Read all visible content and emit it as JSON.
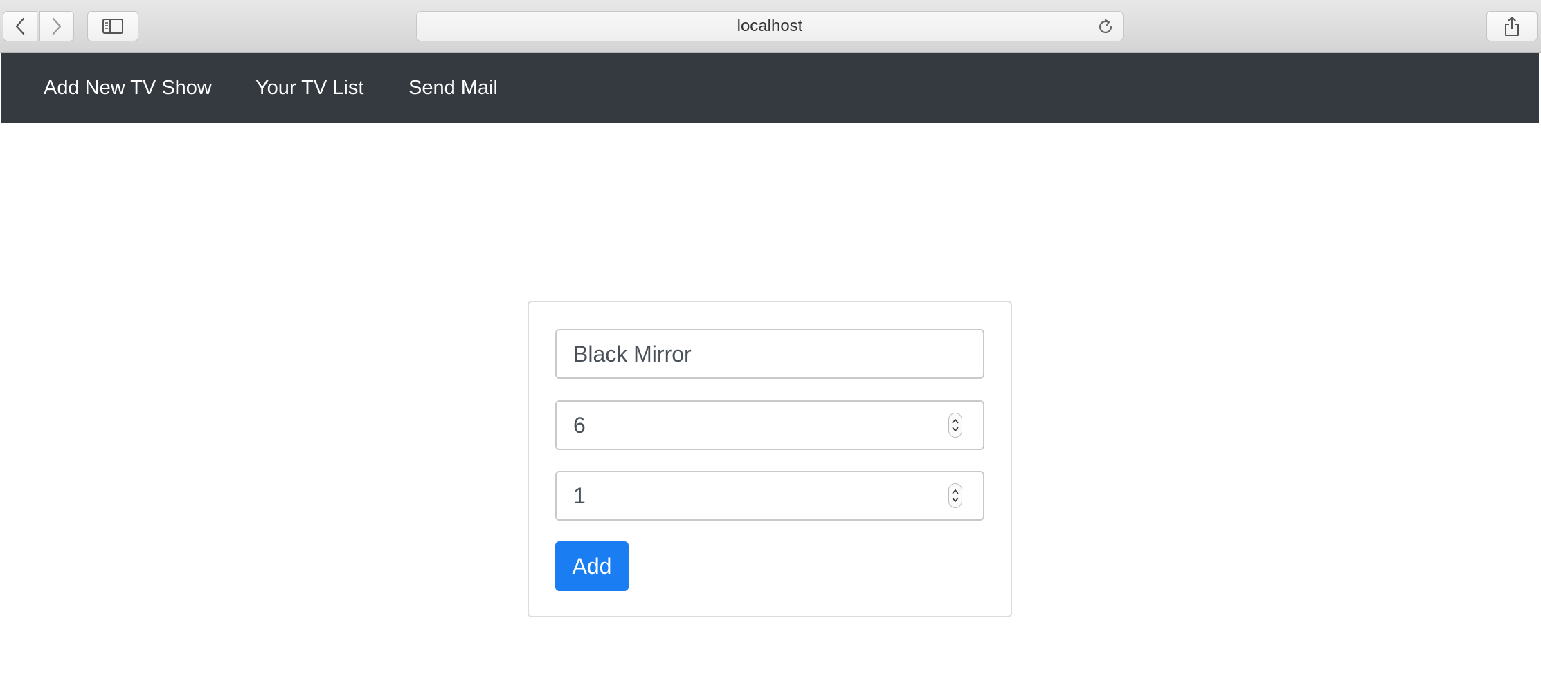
{
  "browser": {
    "url": "localhost",
    "icons": {
      "back": "chevron-left-icon",
      "forward": "chevron-right-icon",
      "sidebar": "sidebar-icon",
      "reload": "reload-icon",
      "share": "share-icon"
    }
  },
  "navbar": {
    "background": "#343a40",
    "links": [
      {
        "label": "Add New TV Show"
      },
      {
        "label": "Your TV List"
      },
      {
        "label": "Send Mail"
      }
    ]
  },
  "form": {
    "title_value": "Black Mirror",
    "seasons_value": "6",
    "episode_value": "1",
    "submit_label": "Add",
    "submit_color": "#1a7ef2"
  }
}
